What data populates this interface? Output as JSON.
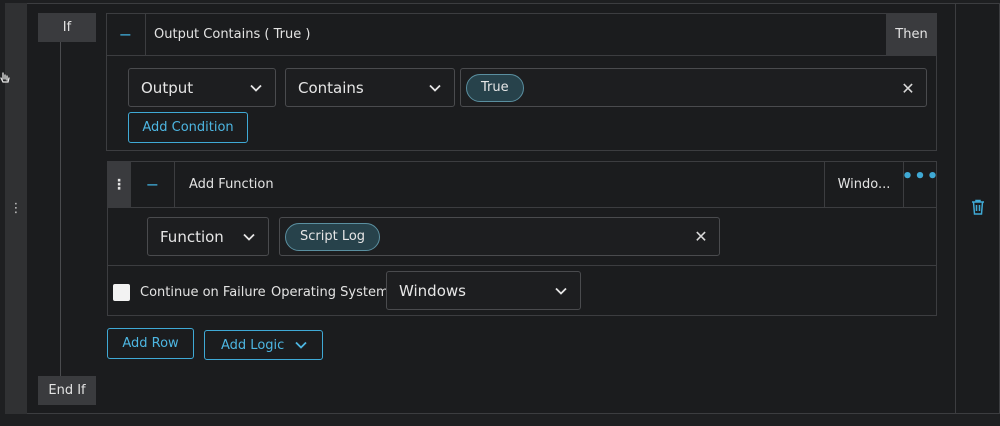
{
  "if_block": {
    "if_label": "If",
    "end_if_label": "End If",
    "then_label": "Then"
  },
  "condition": {
    "collapse_symbol": "−",
    "title": "Output Contains ( True )",
    "field_select": "Output",
    "operator_select": "Contains",
    "values": [
      "True"
    ],
    "clear_symbol": "✕",
    "add_condition_label": "Add Condition"
  },
  "function": {
    "drag_symbol": "⋮",
    "collapse_symbol": "−",
    "title": "Add Function",
    "os_tag": "Windo...",
    "more_symbol": "•••",
    "type_select": "Function",
    "values": [
      "Script Log"
    ],
    "clear_symbol": "✕",
    "continue_on_failure_label": "Continue on Failure",
    "continue_on_failure_checked": false,
    "os_label": "Operating System:",
    "os_select": "Windows"
  },
  "actions": {
    "add_row_label": "Add Row",
    "add_logic_label": "Add Logic"
  },
  "rail": {
    "drag_symbol": "⋮"
  },
  "colors": {
    "accent": "#3fa9d5",
    "background": "#1b1c1e",
    "tab": "#3a3b3e",
    "pill_bg": "#27424b"
  },
  "icons": {
    "trash": "trash-icon",
    "chevron": "chevron-down-icon",
    "cursor": "hand-cursor-icon"
  }
}
